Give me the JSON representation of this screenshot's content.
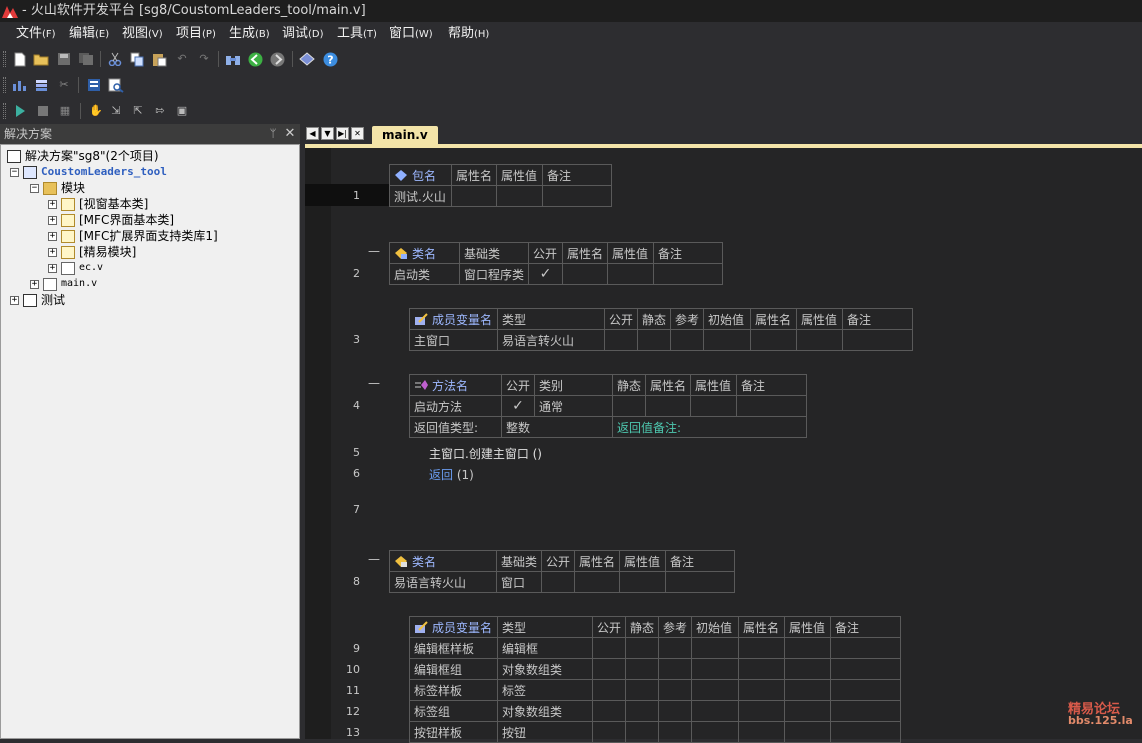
{
  "window": {
    "title": "- 火山软件开发平台 [sg8/CoustomLeaders_tool/main.v]"
  },
  "menu": [
    {
      "label": "文件",
      "acc": "(F)"
    },
    {
      "label": "编辑",
      "acc": "(E)"
    },
    {
      "label": "视图",
      "acc": "(V)"
    },
    {
      "label": "项目",
      "acc": "(P)"
    },
    {
      "label": "生成",
      "acc": "(B)"
    },
    {
      "label": "调试",
      "acc": "(D)"
    },
    {
      "label": "工具",
      "acc": "(T)"
    },
    {
      "label": "窗口",
      "acc": "(W)"
    },
    {
      "label": "帮助",
      "acc": "(H)"
    }
  ],
  "solution": {
    "panel_title": "解决方案",
    "pin": "ᛘ",
    "close": "✕",
    "root": "解决方案\"sg8\"(2个项目)",
    "project": "CoustomLeaders_tool",
    "modules_folder": "模块",
    "modules": [
      "[视窗基本类]",
      "[MFC界面基本类]",
      "[MFC扩展界面支持类库1]",
      "[精易模块]"
    ],
    "ec_file": "ec.v",
    "main_file": "main.v",
    "test_project": "测试"
  },
  "editor": {
    "tab_label": "main.v",
    "nav": [
      "◀",
      "▼",
      "▶|",
      "✕"
    ],
    "line_numbers": [
      "1",
      "2",
      "3",
      "4",
      "5",
      "6",
      "7",
      "8",
      "9",
      "10",
      "11",
      "12",
      "13"
    ],
    "collapse": "—",
    "pkg": {
      "headers": [
        "包名",
        "属性名",
        "属性值",
        "备注"
      ],
      "row": [
        "测试.火山",
        "",
        "",
        ""
      ]
    },
    "class1": {
      "headers": [
        "类名",
        "基础类",
        "公开",
        "属性名",
        "属性值",
        "备注"
      ],
      "row": [
        "启动类",
        "窗口程序类",
        "✓",
        "",
        "",
        ""
      ]
    },
    "members1": {
      "headers": [
        "成员变量名",
        "类型",
        "公开",
        "静态",
        "参考",
        "初始值",
        "属性名",
        "属性值",
        "备注"
      ],
      "row": [
        "主窗口",
        "易语言转火山",
        "",
        "",
        "",
        "",
        "",
        "",
        ""
      ]
    },
    "method": {
      "headers": [
        "方法名",
        "公开",
        "类别",
        "静态",
        "属性名",
        "属性值",
        "备注"
      ],
      "row": [
        "启动方法",
        "✓",
        "通常",
        "",
        "",
        "",
        ""
      ],
      "ret_type_label": "返回值类型:",
      "ret_type": "整数",
      "ret_note_label": "返回值备注:"
    },
    "code_lines": [
      {
        "call": "主窗口.创建主窗口 ()"
      },
      {
        "kw": "返回",
        "arg": " (1)"
      }
    ],
    "class2": {
      "headers": [
        "类名",
        "基础类",
        "公开",
        "属性名",
        "属性值",
        "备注"
      ],
      "row": [
        "易语言转火山",
        "窗口",
        "",
        "",
        "",
        ""
      ]
    },
    "members2": {
      "headers": [
        "成员变量名",
        "类型",
        "公开",
        "静态",
        "参考",
        "初始值",
        "属性名",
        "属性值",
        "备注"
      ],
      "rows": [
        [
          "编辑框样板",
          "编辑框"
        ],
        [
          "编辑框组",
          "对象数组类"
        ],
        [
          "标签样板",
          "标签"
        ],
        [
          "标签组",
          "对象数组类"
        ],
        [
          "按钮样板",
          "按钮"
        ]
      ]
    }
  },
  "watermark": {
    "line1": "精易论坛",
    "line2": "bbs.125.la"
  },
  "colors": {
    "accent_tab": "#f3e4a8",
    "editor_bg": "#252526",
    "type_green": "#4ec9b0",
    "keyword_blue": "#9db8ff"
  }
}
